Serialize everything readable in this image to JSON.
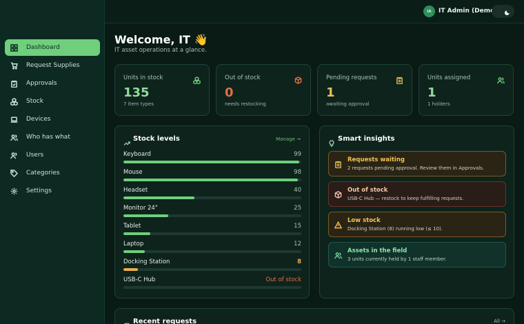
{
  "nav": {
    "items": [
      {
        "label": "Dashboard"
      },
      {
        "label": "Request Supplies"
      },
      {
        "label": "Approvals"
      },
      {
        "label": "Stock"
      },
      {
        "label": "Devices"
      },
      {
        "label": "Who has what"
      },
      {
        "label": "Users"
      },
      {
        "label": "Categories"
      },
      {
        "label": "Settings"
      }
    ]
  },
  "header": {
    "avatar_initials": "IA",
    "user_name": "IT Admin (Demo)"
  },
  "welcome": {
    "title": "Welcome, IT 👋",
    "subtitle": "IT asset operations at a glance."
  },
  "stats": [
    {
      "label": "Units in stock",
      "value": "135",
      "note": "7 item types",
      "color": "#8fdc9a",
      "icon": "boxes-icon"
    },
    {
      "label": "Out of stock",
      "value": "0",
      "note": "needs restocking",
      "color": "#e0704a",
      "icon": "package-x-icon"
    },
    {
      "label": "Pending requests",
      "value": "1",
      "note": "awaiting approval",
      "color": "#e8c05a",
      "icon": "clipboard-icon"
    },
    {
      "label": "Units assigned",
      "value": "1",
      "note": "1 holders",
      "color": "#8fdc9a",
      "icon": "users-icon"
    }
  ],
  "stock_levels": {
    "title": "Stock levels",
    "manage_label": "Manage →",
    "max": 100,
    "items": [
      {
        "name": "Keyboard",
        "qty": "99",
        "value": 99,
        "status": "ok"
      },
      {
        "name": "Mouse",
        "qty": "98",
        "value": 98,
        "status": "ok"
      },
      {
        "name": "Headset",
        "qty": "40",
        "value": 40,
        "status": "ok"
      },
      {
        "name": "Monitor 24\"",
        "qty": "25",
        "value": 25,
        "status": "ok"
      },
      {
        "name": "Tablet",
        "qty": "15",
        "value": 15,
        "status": "ok"
      },
      {
        "name": "Laptop",
        "qty": "12",
        "value": 12,
        "status": "ok"
      },
      {
        "name": "Docking Station",
        "qty": "8",
        "value": 8,
        "status": "low"
      },
      {
        "name": "USB-C Hub",
        "qty": "Out of stock",
        "value": 0,
        "status": "out"
      }
    ]
  },
  "insights": {
    "title": "Smart insights",
    "items": [
      {
        "title": "Requests waiting",
        "desc": "2 requests pending approval. Review them in Approvals.",
        "tone": "amber",
        "icon": "clipboard-icon"
      },
      {
        "title": "Out of stock",
        "desc": "USB-C Hub — restock to keep fulfilling requests.",
        "tone": "red",
        "icon": "package-icon"
      },
      {
        "title": "Low stock",
        "desc": "Docking Station (8) running low (≤ 10).",
        "tone": "amber",
        "icon": "warning-icon"
      },
      {
        "title": "Assets in the field",
        "desc": "3 units currently held by 1 staff member.",
        "tone": "green",
        "icon": "users-icon"
      }
    ]
  },
  "recent": {
    "title": "Recent requests",
    "all_label": "All →"
  },
  "colors": {
    "accent": "#6fcf7c",
    "low": "#e8b04a",
    "out": "#e0704a"
  }
}
